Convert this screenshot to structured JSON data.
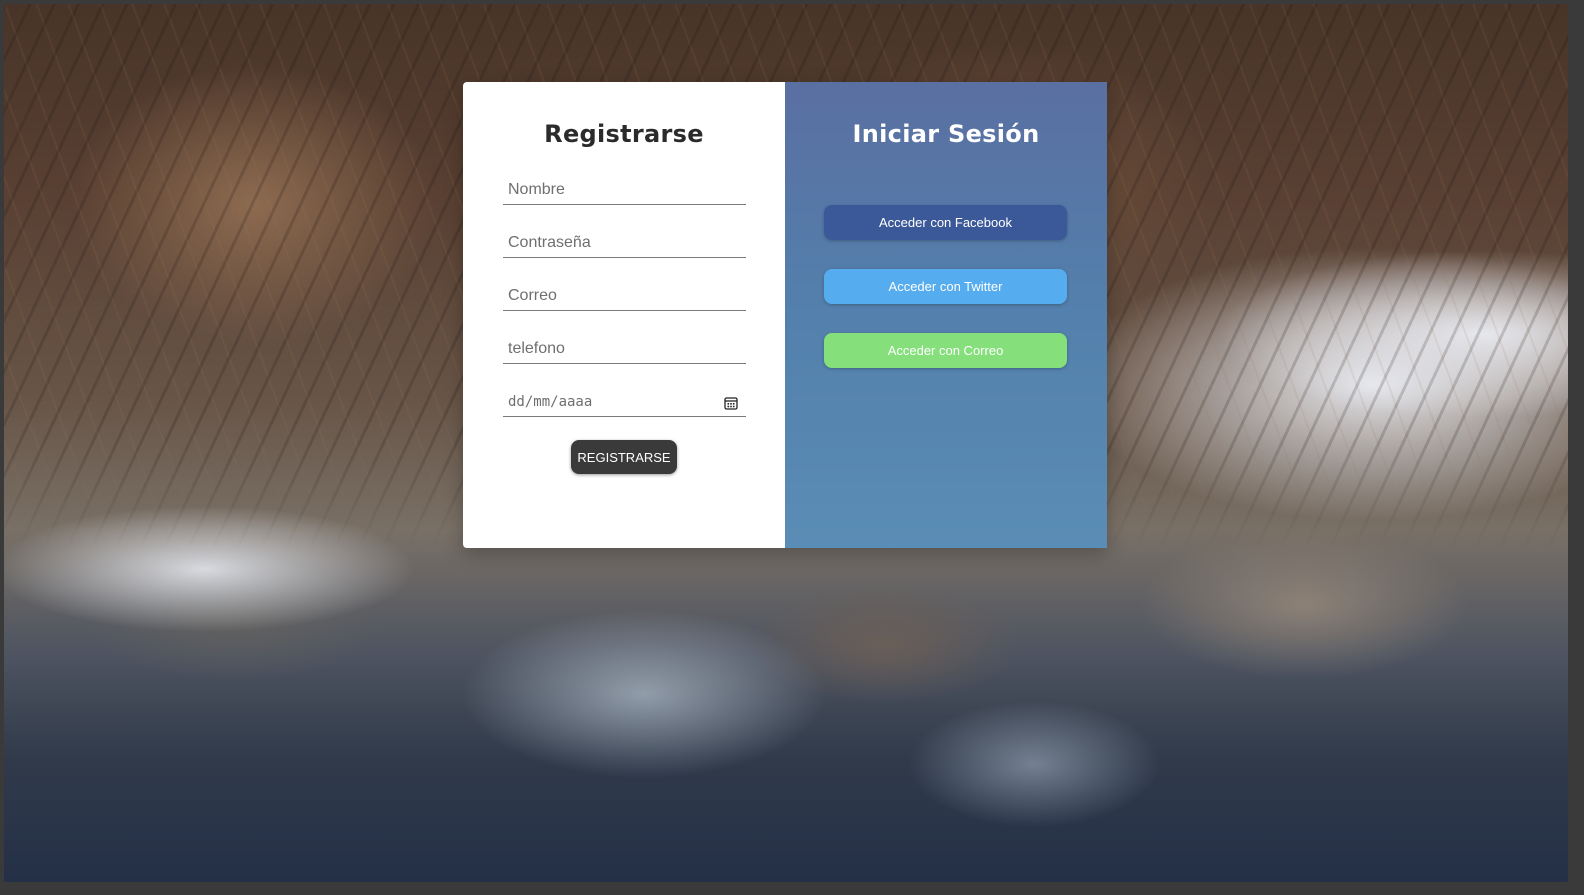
{
  "register": {
    "title": "Registrarse",
    "fields": {
      "name_placeholder": "Nombre",
      "password_placeholder": "Contraseña",
      "email_placeholder": "Correo",
      "phone_placeholder": "telefono",
      "date_placeholder": "dd/mm/aaaa"
    },
    "submit_label": "REGISTRARSE"
  },
  "login": {
    "title": "Iniciar Sesión",
    "facebook_label": "Acceder con Facebook",
    "twitter_label": "Acceder con Twitter",
    "email_label": "Acceder con Correo"
  },
  "colors": {
    "facebook": "#3b5998",
    "twitter": "#55acee",
    "email": "#85e07c",
    "register_button": "#3a3a3a",
    "login_panel": "#5380ac"
  },
  "icons": {
    "date_field": "calendar-icon"
  }
}
